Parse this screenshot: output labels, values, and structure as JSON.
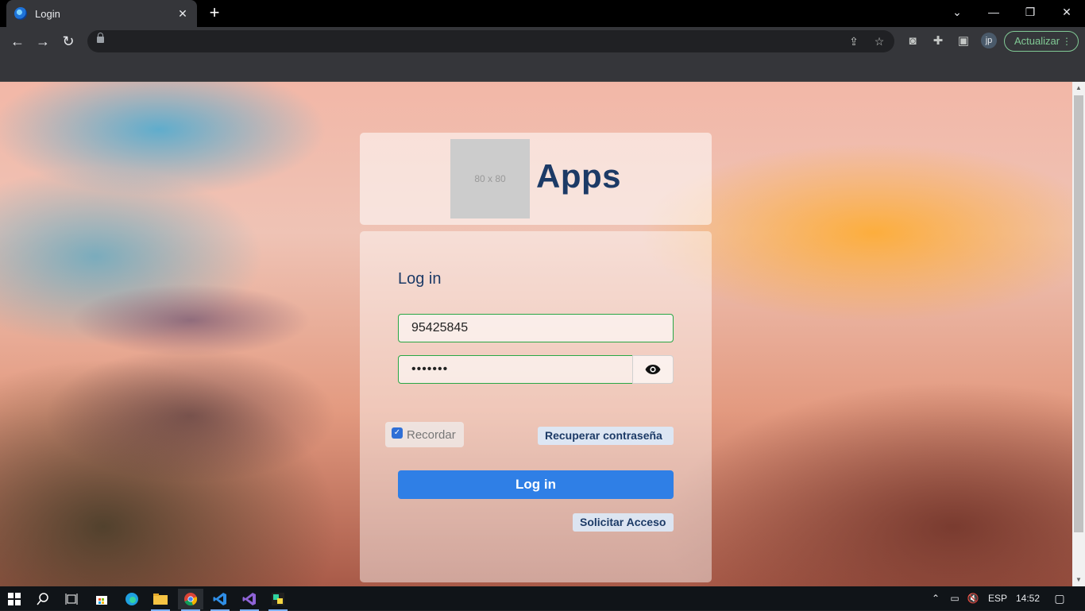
{
  "browser": {
    "tab_title": "Login",
    "update_label": "Actualizar",
    "profile_initials": "jp"
  },
  "app": {
    "logo_placeholder": "80 x 80",
    "title": "Apps"
  },
  "login": {
    "heading": "Log in",
    "username_value": "95425845",
    "password_value": "•••••••",
    "remember_label": "Recordar",
    "remember_checked": true,
    "recover_label": "Recuperar contraseña",
    "submit_label": "Log in",
    "request_access_label": "Solicitar Acceso"
  },
  "taskbar": {
    "language": "ESP",
    "time": "14:52"
  },
  "colors": {
    "accent": "#2f7fe6",
    "title": "#1c3a66",
    "valid_border": "#28a745",
    "update_green": "#81c995"
  }
}
